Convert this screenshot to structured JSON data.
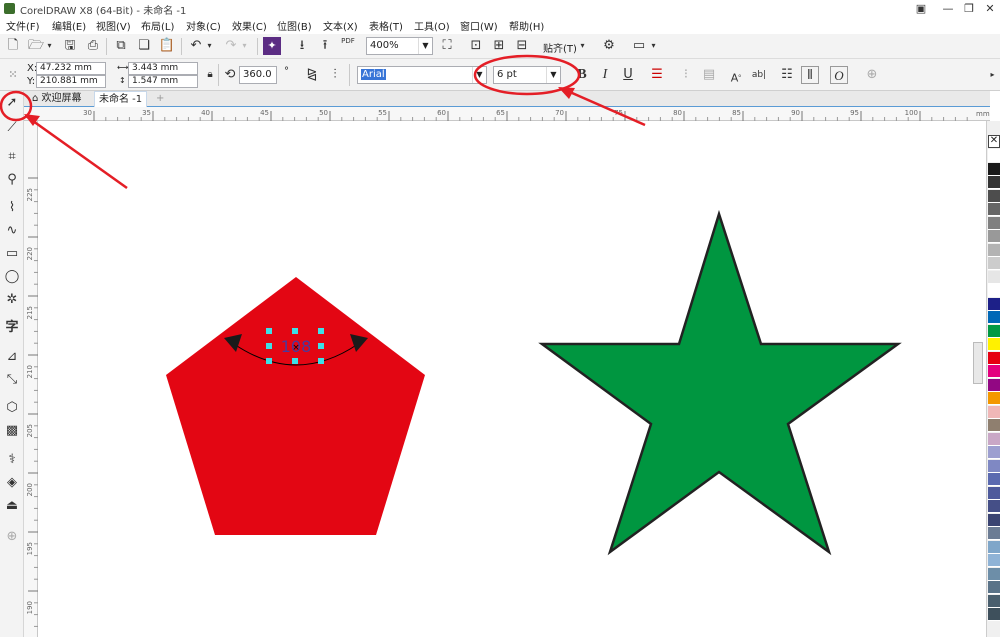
{
  "window": {
    "title": "CorelDRAW X8 (64-Bit) - 未命名 -1",
    "min_icon": "minimize-icon",
    "max_icon": "restore-icon",
    "close_label": "✕"
  },
  "menu": [
    "文件(F)",
    "编辑(E)",
    "视图(V)",
    "布局(L)",
    "对象(C)",
    "效果(C)",
    "位图(B)",
    "文本(X)",
    "表格(T)",
    "工具(O)",
    "窗口(W)",
    "帮助(H)"
  ],
  "standard_toolbar": {
    "zoom_level": "400%",
    "snap_label": "贴齐(T)",
    "pdf_label": "PDF"
  },
  "property_bar": {
    "x_label": "X:",
    "x_value": "47.232 mm",
    "y_label": "Y:",
    "y_value": "210.881 mm",
    "width_value": "3.443 mm",
    "height_value": "1.547 mm",
    "rotation_value": "360.0",
    "degree_symbol": "°",
    "font_name": "Arial",
    "font_size": "6 pt",
    "bold_label": "B",
    "italic_label": "I",
    "underline_label": "U",
    "char_a_label": "A",
    "abl_label": "ab|",
    "o_label": "O"
  },
  "document_tabs": [
    {
      "label": "欢迎屏幕"
    },
    {
      "label": "未命名 -1"
    }
  ],
  "rulers": {
    "h_labels": [
      "30",
      "35",
      "40",
      "45",
      "50",
      "55",
      "60",
      "65",
      "70",
      "75",
      "80",
      "85",
      "90",
      "95",
      "100"
    ],
    "v_labels": [
      "225",
      "220",
      "215",
      "210",
      "205",
      "200",
      "195",
      "190"
    ],
    "unit": "mm"
  },
  "toolbox_icons": [
    "pick-tool-icon",
    "shape-tool-icon",
    "crop-tool-icon",
    "zoom-tool-icon",
    "freehand-tool-icon",
    "artistic-media-icon",
    "rectangle-tool-icon",
    "ellipse-tool-icon",
    "polygon-tool-icon",
    "text-tool-icon",
    "parallel-dimension-icon",
    "connector-tool-icon",
    "drop-shadow-icon",
    "transparency-icon",
    "eyedropper-icon",
    "interactive-fill-icon",
    "smart-fill-icon",
    "add-tool-icon"
  ],
  "canvas": {
    "pentagon_fill": "#e30613",
    "star_fill": "#009640",
    "dimension_text": "108",
    "handle_color": "#3de0e8",
    "annotation_color": "#e41e26"
  },
  "palette_colors": [
    "#ffffff",
    "#1a1a1a",
    "#333333",
    "#4d4d4d",
    "#666666",
    "#808080",
    "#999999",
    "#b3b3b3",
    "#cccccc",
    "#e6e6e6",
    "#ffffff",
    "#1d2088",
    "#0068b7",
    "#009944",
    "#fff100",
    "#e60012",
    "#e4007f",
    "#920783",
    "#f39800",
    "#f0b7b7",
    "#8f7f6f",
    "#c9a7c6",
    "#9d9fd0",
    "#7f88c3",
    "#5b6ab0",
    "#4e5a9c",
    "#454f87",
    "#3b4472",
    "#6c7c94",
    "#7fa6c9",
    "#8fb3d6",
    "#6d8ea8",
    "#5a7388",
    "#4a5f6e",
    "#3e505c"
  ]
}
